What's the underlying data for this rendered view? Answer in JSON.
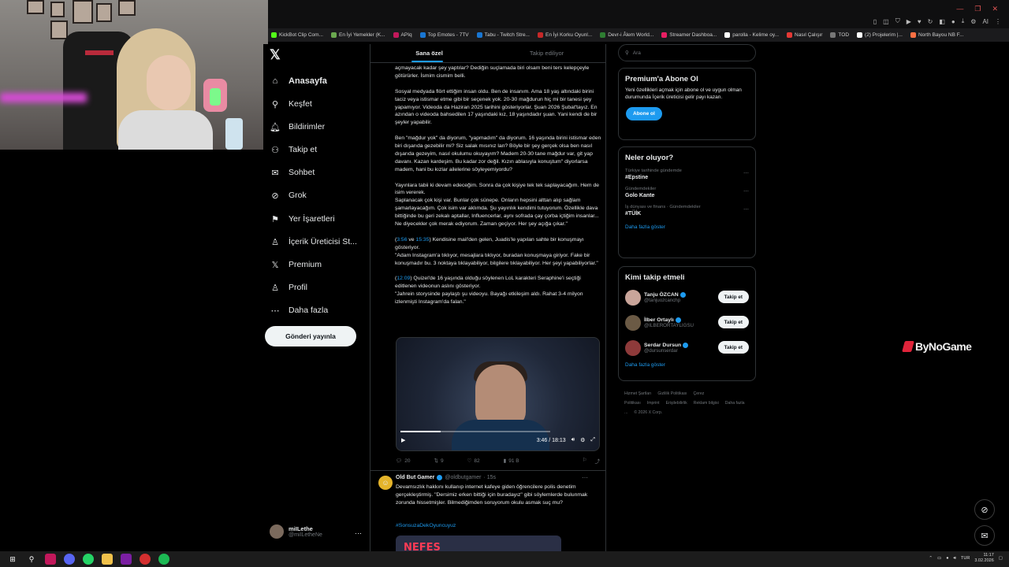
{
  "browser": {
    "bookmarks": [
      {
        "label": "KickBot Clip Com...",
        "color": "#53fc18"
      },
      {
        "label": "En İyi Yemekler (K...",
        "color": "#6aa84f"
      },
      {
        "label": "APIq",
        "color": "#c2185b"
      },
      {
        "label": "Top Emotes - 7TV",
        "color": "#1976d2"
      },
      {
        "label": "Tabu - Twitch Stre...",
        "color": "#1976d2"
      },
      {
        "label": "En İyi Korku Oyunl...",
        "color": "#c62828"
      },
      {
        "label": "Devr-i Âlem World...",
        "color": "#2e7d32"
      },
      {
        "label": "Streamer Dashboa...",
        "color": "#e91e63"
      },
      {
        "label": "parolla - Kelime oy...",
        "color": "#ffffff"
      },
      {
        "label": "Nasıl Çalışır",
        "color": "#e53935"
      },
      {
        "label": "TOD",
        "color": "#777777"
      },
      {
        "label": "(2) Projelerim |...",
        "color": "#ffffff"
      },
      {
        "label": "North Bayou NB F...",
        "color": "#ff7043"
      }
    ],
    "ext_label": "AI"
  },
  "nav": {
    "items": [
      {
        "label": "Anasayfa",
        "icon": "home-icon",
        "glyph": "⌂",
        "active": true
      },
      {
        "label": "Keşfet",
        "icon": "search-icon",
        "glyph": "⚲",
        "active": false
      },
      {
        "label": "Bildirimler",
        "icon": "bell-icon",
        "glyph": "🔔︎",
        "active": false
      },
      {
        "label": "Takip et",
        "icon": "follow-icon",
        "glyph": "⚇",
        "active": false
      },
      {
        "label": "Sohbet",
        "icon": "mail-icon",
        "glyph": "✉",
        "active": false
      },
      {
        "label": "Grok",
        "icon": "grok-icon",
        "glyph": "⊘",
        "active": false
      },
      {
        "label": "Yer İşaretleri",
        "icon": "bookmark-icon",
        "glyph": "⚑",
        "active": false
      },
      {
        "label": "İçerik Üreticisi St...",
        "icon": "creator-icon",
        "glyph": "♙",
        "active": false
      },
      {
        "label": "Premium",
        "icon": "premium-icon",
        "glyph": "𝕏",
        "active": false
      },
      {
        "label": "Profil",
        "icon": "profile-icon",
        "glyph": "♙",
        "active": false
      },
      {
        "label": "Daha fazla",
        "icon": "more-icon",
        "glyph": "⋯",
        "active": false
      }
    ],
    "post_button": "Gönderi yayınla",
    "profile_name": "miILethe",
    "profile_handle": "@miILetheNe"
  },
  "feed": {
    "tabs": [
      "Sana özel",
      "Takip ediliyor"
    ],
    "p0": "açmayacak kadar şey yaptılar? Dediğin suçlamada biri olsam beni ters kelepçeyle götürürler. İsmim cismim belli.",
    "p1": "Sosyal medyada flört ettiğim insan oldu. Ben de insanım. Ama 18 yaş altındaki birini taciz veya istismar etme gibi bir seçenek yok. 20-30 mağdurun hiç mi bir tanesi şey yapamıyor. Videoda da Haziran 2025 tarihini gösteriyorlar. Şuan 2026 Şubat'tayız. En azından o videoda bahsedilen 17 yaşındaki kız, 18 yaşındadır şuan. Yani kendi de bir şeyler yapabilir.",
    "p2": "Ben \"mağdur yok\" da diyorum, \"yapmadım\" da diyorum. 16 yaşında birini istismar eden biri dışarıda gezebilir mi? Siz salak mısınız lan? Böyle bir şey gerçek olsa ben nasıl dışarıda gezeyim, nasıl okulumu okuyayım? Madem 20-30 tane mağdur var, git yap davanı. Kazan kardeşim. Bu kadar zor değil. Kızın ablasıyla konuştum\" diyorlarsa madem, hani bu kızlar ailelerine söyleyemiyordu?",
    "p3": "Yayınlara tabii ki devam edeceğim. Sonra da çok kişiye tek tek saplayacağım. Hem de isim vererek.\nSaplanacak çok kişi var. Bunlar çok sünepe. Onların hepsini alttan alıp sağlam şamarlayacağım. Çok isim var aklımda. Şu yayınlık kendimi tutuyorum. Özellikle dava bittiğinde bu geri zekalı aptallar, Influencerlar, aynı sofrada çay çorba içtiğim insanlar... Ne diyecekler çok merak ediyorum. Zaman geçiyor. Her şey açığa çıkar.\"",
    "p4_ts1": "3:56",
    "p4_mid": " ve ",
    "p4_ts2": "15:35",
    "p4_rest": ") Kendisine mail'den gelen, Juadis'le yapılan sahte bir konuşmayı gösteriyor.\n\"Adam Instagram'a tıklıyor, mesajlara tıklıyor, buradan konuşmaya giriyor. Fake bir konuşmadır bu. 3 noktaya tıklayabiliyor, bilgilere tıklayabiliyor. Her şeyi yapabiliyorlar.\"",
    "p5_ts": "12:09",
    "p5_rest": ") Quizel'de 16 yaşında olduğu söylenen LoL karakteri Seraphine'i seçtiği editlenen videonun aslını gösteriyor.\n\"Jahrein storysinde paylaştı şu videoyu. Bayağı etkileşim aldı. Rahat 3-4 milyon izlenmişti Instagram'da falan.\"",
    "video_time": "3:46 / 18:13",
    "video_progress": 0.27,
    "replies": "20",
    "reposts": "9",
    "likes": "82",
    "views": "91 B",
    "post2": {
      "name": "Old But Gamer",
      "handle": "@oldbutgamer",
      "time": "· 15s",
      "text": "Devamsızlık hakkını kullanıp internet kafeye giden öğrencilere polis denetim gerçekleştirmiş. \"Dersimiz erken bittiği için buradayız\" gibi söylemlerde bulunmak zorunda hissetmişler. Bilmediğimden soruyorum okulu asmak suç mu?",
      "tag": "#SonsuzaDekOyuncuyuz",
      "image_text": "NEFES"
    }
  },
  "right": {
    "search_placeholder": "Ara",
    "premium_title": "Premium'a Abone Ol",
    "premium_text": "Yeni özellikleri açmak için abone ol ve uygun olman durumunda İçerik üreticisi gelir payı kazan.",
    "premium_button": "Abone ol",
    "trends_title": "Neler oluyor?",
    "trends": [
      {
        "context": "Türkiye tarihinde gündemde",
        "name": "#Epstine"
      },
      {
        "context": "Gündemdekiler",
        "name": "Golo Kante"
      },
      {
        "context": "İş dünyası ve finans · Gündemdekiler",
        "name": "#TÜİK"
      }
    ],
    "show_more": "Daha fazla göster",
    "who_title": "Kimi takip etmeli",
    "who": [
      {
        "name": "Tanju ÖZCAN",
        "handle": "@tanjuozcanchp",
        "color": "#c9a59a"
      },
      {
        "name": "İlber Ortaylı",
        "handle": "@ILBERORTAYLIGSU",
        "color": "#6b5a45"
      },
      {
        "name": "Serdar Dursun",
        "handle": "@dursunserdar",
        "color": "#8e3a3a"
      }
    ],
    "follow_label": "Takip et",
    "footer": [
      "Hizmet Şartları",
      "Gizlilik Politikası",
      "Çerez Politikası",
      "Imprint",
      "Erişilebilirlik",
      "Reklam bilgisi",
      "Daha fazla ...",
      "© 2026 X Corp."
    ]
  },
  "overlay": {
    "brand": "ByNoGame"
  },
  "taskbar": {
    "lang": "TUR",
    "time": "11:17",
    "date": "3.02.2026"
  }
}
